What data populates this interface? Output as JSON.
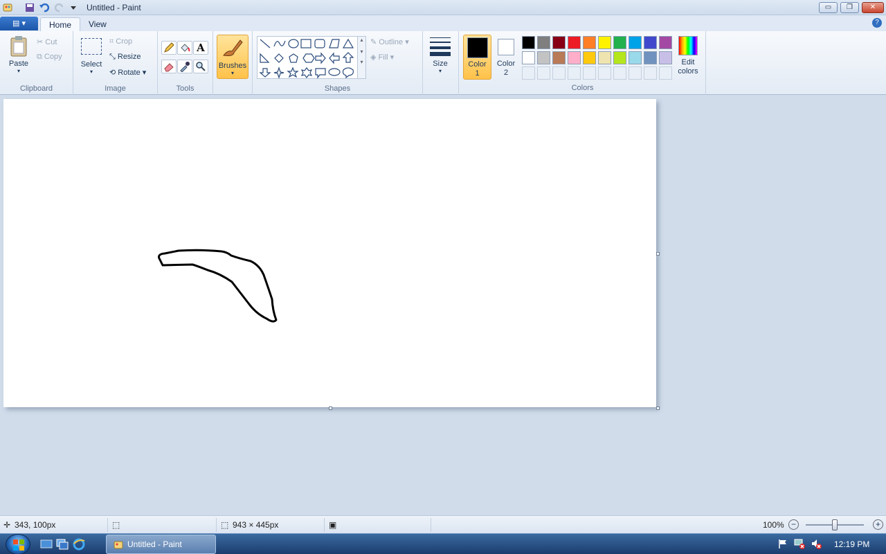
{
  "window": {
    "title": "Untitled - Paint",
    "minimize": "▭",
    "maximize": "❐",
    "close": "✕"
  },
  "tabs": {
    "file": "▤ ▾",
    "home": "Home",
    "view": "View",
    "help": "?"
  },
  "clipboard": {
    "paste": "Paste",
    "cut": "Cut",
    "copy": "Copy",
    "group_label": "Clipboard"
  },
  "image": {
    "select": "Select",
    "crop": "Crop",
    "resize": "Resize",
    "rotate": "Rotate",
    "group_label": "Image"
  },
  "tools": {
    "group_label": "Tools",
    "text_tool_glyph": "A"
  },
  "brushes": {
    "label": "Brushes"
  },
  "shapes": {
    "outline": "Outline",
    "fill": "Fill",
    "group_label": "Shapes"
  },
  "size": {
    "label": "Size"
  },
  "colors": {
    "color1": "Color 1",
    "color2": "Color 2",
    "edit": "Edit colors",
    "group_label": "Colors",
    "color1_value": "#000000",
    "color2_value": "#ffffff",
    "palette_row1": [
      "#000000",
      "#7f7f7f",
      "#880015",
      "#ed1c24",
      "#ff7f27",
      "#fff200",
      "#22b14c",
      "#00a2e8",
      "#3f48cc",
      "#a349a4"
    ],
    "palette_row2": [
      "#ffffff",
      "#c3c3c3",
      "#b97a57",
      "#ffaec9",
      "#ffc90e",
      "#efe4b0",
      "#b5e61d",
      "#99d9ea",
      "#7092be",
      "#c8bfe7"
    ]
  },
  "status": {
    "cursor": "343, 100px",
    "canvas_size": "943 × 445px",
    "zoom": "100%"
  },
  "taskbar": {
    "app": "Untitled - Paint",
    "clock": "12:19 PM"
  }
}
